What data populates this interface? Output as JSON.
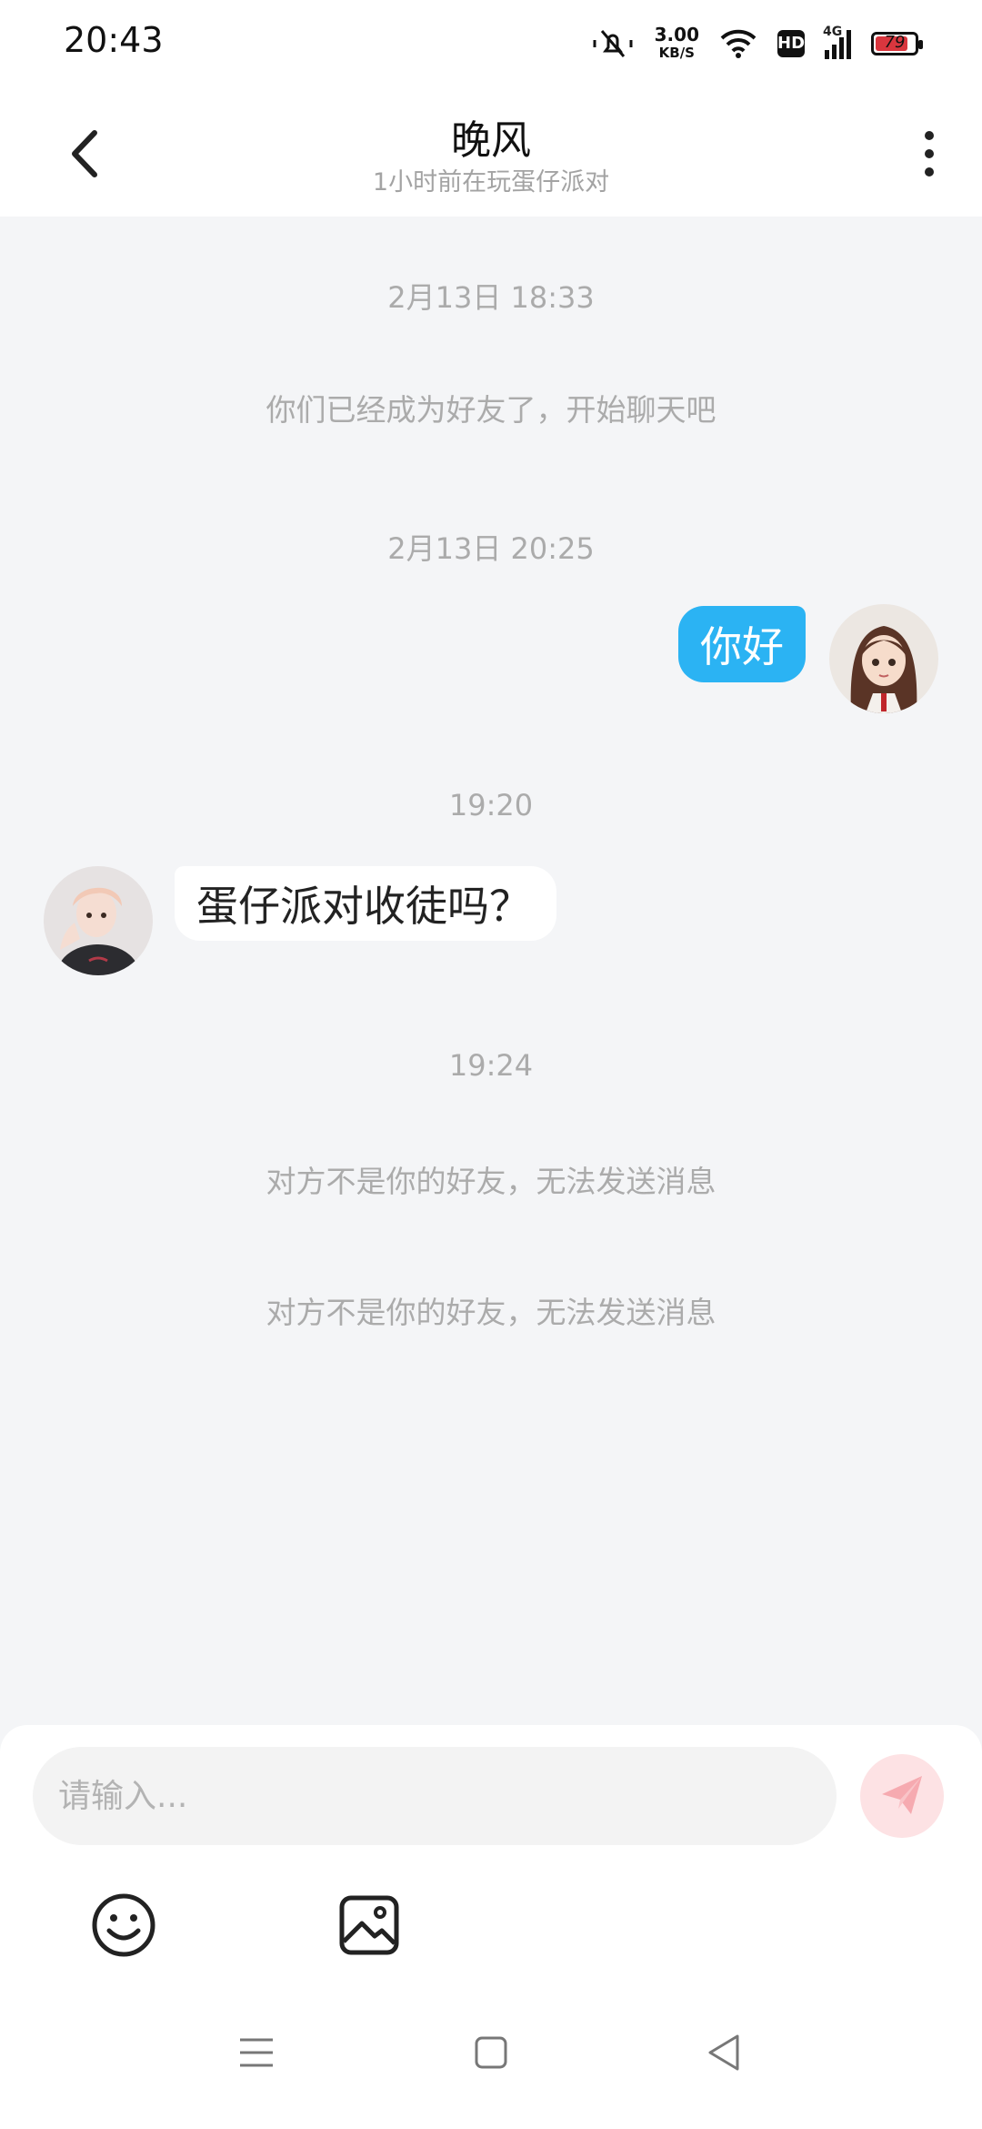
{
  "status_bar": {
    "time": "20:43",
    "net_speed_value": "3.00",
    "net_speed_unit": "KB/S",
    "hd_label": "HD",
    "network_type": "4G",
    "battery_level": "79",
    "icons": [
      "mute-bell-icon",
      "wifi-icon",
      "hd-icon",
      "signal-icon",
      "battery-icon"
    ]
  },
  "header": {
    "title": "晚风",
    "subtitle": "1小时前在玩蛋仔派对"
  },
  "chat": {
    "timestamps": [
      "2月13日 18:33",
      "2月13日 20:25",
      "19:20",
      "19:24"
    ],
    "system_friend_added": "你们已经成为好友了，开始聊天吧",
    "messages": [
      {
        "side": "me",
        "text": "你好"
      },
      {
        "side": "other",
        "text": "蛋仔派对收徒吗？"
      }
    ],
    "system_not_friend": [
      "对方不是你的好友，无法发送消息",
      "对方不是你的好友，无法发送消息"
    ]
  },
  "composer": {
    "placeholder": "请输入...",
    "value": ""
  },
  "colors": {
    "my_bubble": "#2bb3f3",
    "send_button_bg": "#fde2e4",
    "send_icon": "#f6aab0",
    "chat_background": "#f4f5f7"
  }
}
